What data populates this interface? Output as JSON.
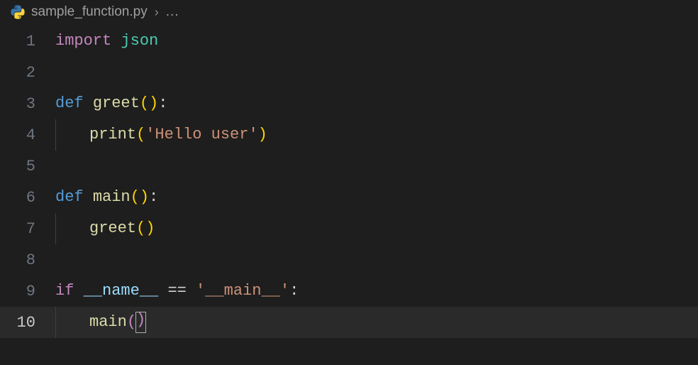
{
  "breadcrumb": {
    "filename": "sample_function.py",
    "chevron": "›",
    "rest": "..."
  },
  "lines": {
    "l1": {
      "num": "1",
      "import": "import",
      "space": " ",
      "mod": "json"
    },
    "l2": {
      "num": "2"
    },
    "l3": {
      "num": "3",
      "def": "def",
      "sp": " ",
      "name": "greet",
      "p1": "(",
      "p2": ")",
      "colon": ":"
    },
    "l4": {
      "num": "4",
      "call": "print",
      "p1": "(",
      "str": "'Hello user'",
      "p2": ")"
    },
    "l5": {
      "num": "5"
    },
    "l6": {
      "num": "6",
      "def": "def",
      "sp": " ",
      "name": "main",
      "p1": "(",
      "p2": ")",
      "colon": ":"
    },
    "l7": {
      "num": "7",
      "call": "greet",
      "p1": "(",
      "p2": ")"
    },
    "l8": {
      "num": "8"
    },
    "l9": {
      "num": "9",
      "if": "if",
      "sp": " ",
      "dunder": "__name__",
      "sp2": " ",
      "eq": "==",
      "sp3": " ",
      "str": "'__main__'",
      "colon": ":"
    },
    "l10": {
      "num": "10",
      "call": "main",
      "p1": "(",
      "p2": ")"
    }
  }
}
